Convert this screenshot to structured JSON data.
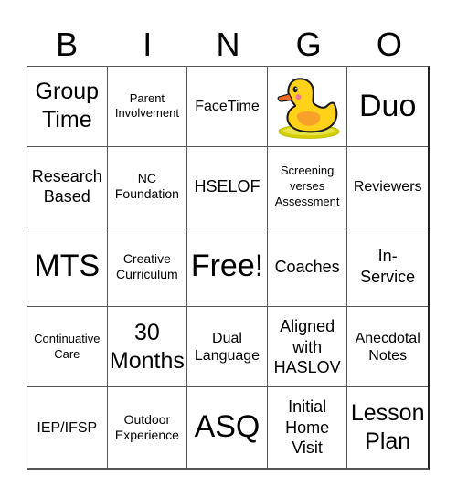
{
  "header": {
    "letters": [
      "B",
      "I",
      "N",
      "G",
      "O"
    ]
  },
  "colors": {
    "grid_line": "#555555",
    "duck_body": "#FFD21A",
    "duck_wing": "#F7A12A",
    "duck_beak": "#F26A21",
    "duck_cheek": "#F47A8A",
    "duck_base": "#D4D000"
  },
  "board": {
    "rows": [
      [
        {
          "text": "Group\nTime",
          "size": "s-l"
        },
        {
          "text": "Parent\nInvolvement",
          "size": "s-xs"
        },
        {
          "text": "FaceTime",
          "size": "s-sm"
        },
        {
          "text": "",
          "icon": "rubber-duck-icon",
          "free_image": true
        },
        {
          "text": "Duo",
          "size": "s-xl"
        }
      ],
      [
        {
          "text": "Research\nBased",
          "size": "s-m"
        },
        {
          "text": "NC\nFoundation",
          "size": "s-s"
        },
        {
          "text": "HSELOF",
          "size": "s-m"
        },
        {
          "text": "Screening\nverses\nAssessment",
          "size": "s-xs"
        },
        {
          "text": "Reviewers",
          "size": "s-sm"
        }
      ],
      [
        {
          "text": "MTS",
          "size": "s-xl"
        },
        {
          "text": "Creative\nCurriculum",
          "size": "s-s"
        },
        {
          "text": "Free!",
          "size": "s-xl"
        },
        {
          "text": "Coaches",
          "size": "s-m"
        },
        {
          "text": "In-\nService",
          "size": "s-m"
        }
      ],
      [
        {
          "text": "Continuative\nCare",
          "size": "s-xs"
        },
        {
          "text": "30\nMonths",
          "size": "s-l"
        },
        {
          "text": "Dual\nLanguage",
          "size": "s-sm"
        },
        {
          "text": "Aligned\nwith\nHASLOV",
          "size": "s-m"
        },
        {
          "text": "Anecdotal\nNotes",
          "size": "s-sm"
        }
      ],
      [
        {
          "text": "IEP/IFSP",
          "size": "s-sm"
        },
        {
          "text": "Outdoor\nExperience",
          "size": "s-s"
        },
        {
          "text": "ASQ",
          "size": "s-xl"
        },
        {
          "text": "Initial\nHome\nVisit",
          "size": "s-m"
        },
        {
          "text": "Lesson\nPlan",
          "size": "s-l"
        }
      ]
    ]
  }
}
